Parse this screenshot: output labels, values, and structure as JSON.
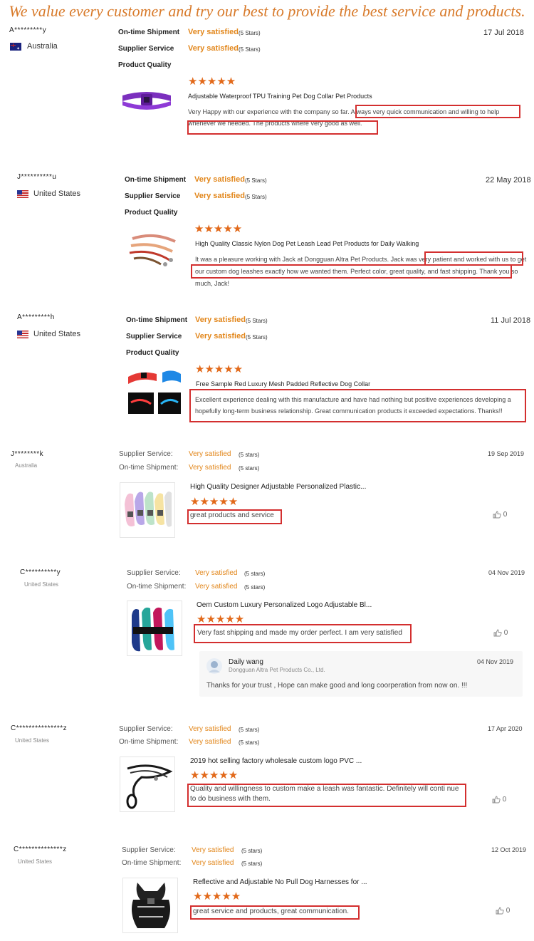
{
  "banner": "We value every customer and try our best to provide the best service and products.",
  "stars_glyph": "★★★★★",
  "like_icon": "thumbs-up-icon",
  "colors": {
    "accent": "#e2861a",
    "highlight": "#d32f2f",
    "banner": "#d87a2a"
  },
  "reviews": [
    {
      "user": "A*********y",
      "country": "Australia",
      "date": "17 Jul 2018",
      "label_shipment": "On-time Shipment",
      "label_service": "Supplier Service",
      "label_quality": "Product Quality",
      "rating_text": "Very satisfied",
      "stars_label": "(5 Stars)",
      "product": "Adjustable Waterproof TPU Training Pet Dog Collar Pet Products",
      "comment": "Very Happy with our experience with the company so far. Always very quick communication and willing to help whenever we needed. The products where very good as well."
    },
    {
      "user": "J**********u",
      "country": "United States",
      "date": "22 May 2018",
      "label_shipment": "On-time Shipment",
      "label_service": "Supplier Service",
      "label_quality": "Product Quality",
      "rating_text": "Very satisfied",
      "stars_label": "(5 Stars)",
      "product": "High Quality Classic Nylon Dog Pet Leash Lead Pet Products for Daily Walking",
      "comment": "It was a pleasure working with Jack at Dongguan Altra Pet Products. Jack was very patient and worked with us to get our custom dog leashes exactly how we wanted them. Perfect color, great quality, and fast shipping. Thank you so much, Jack!"
    },
    {
      "user": "A*********h",
      "country": "United States",
      "date": "11 Jul 2018",
      "label_shipment": "On-time Shipment",
      "label_service": "Supplier Service",
      "label_quality": "Product Quality",
      "rating_text": "Very satisfied",
      "stars_label": "(5 Stars)",
      "product": "Free Sample Red Luxury Mesh Padded Reflective Dog Collar",
      "comment": "Excellent experience dealing with this manufacture and have had nothing but positive experiences developing a hopefully long-term business relationship. Great communication products it exceeded expectations. Thanks!!"
    },
    {
      "user": "J********k",
      "country": "Australia",
      "date": "19 Sep 2019",
      "label_service": "Supplier Service:",
      "label_shipment": "On-time Shipment:",
      "rating_text": "Very satisfied",
      "stars_label": "(5 stars)",
      "product": "High Quality Designer Adjustable Personalized Plastic...",
      "comment": "great products and service",
      "likes": "0"
    },
    {
      "user": "C**********y",
      "country": "United States",
      "date": "04 Nov 2019",
      "label_service": "Supplier Service:",
      "label_shipment": "On-time Shipment:",
      "rating_text": "Very satisfied",
      "stars_label": "(5 stars)",
      "product": "Oem Custom Luxury Personalized Logo Adjustable Bl...",
      "comment": "Very fast shipping and made my order perfect. I am very satisfied",
      "likes": "0",
      "reply": {
        "name": "Daily wang",
        "company": "Dongguan Altra Pet Products Co., Ltd.",
        "date": "04 Nov 2019",
        "text": "Thanks for your trust , Hope can make good and long coorperation from now on. !!!"
      }
    },
    {
      "user": "C***************z",
      "country": "United States",
      "date": "17 Apr 2020",
      "label_service": "Supplier Service:",
      "label_shipment": "On-time Shipment:",
      "rating_text": "Very satisfied",
      "stars_label": "(5 stars)",
      "product": "2019 hot selling factory wholesale custom logo PVC ...",
      "comment": "Quality and willingness to custom make a leash was fantastic. Definitely will conti nue to do business with them.",
      "likes": "0"
    },
    {
      "user": "C**************z",
      "country": "United States",
      "date": "12 Oct 2019",
      "label_service": "Supplier Service:",
      "label_shipment": "On-time Shipment:",
      "rating_text": "Very satisfied",
      "stars_label": "(5 stars)",
      "product": "Reflective and Adjustable No Pull Dog Harnesses for ...",
      "comment": "great service and products, great communication.",
      "likes": "0"
    }
  ]
}
